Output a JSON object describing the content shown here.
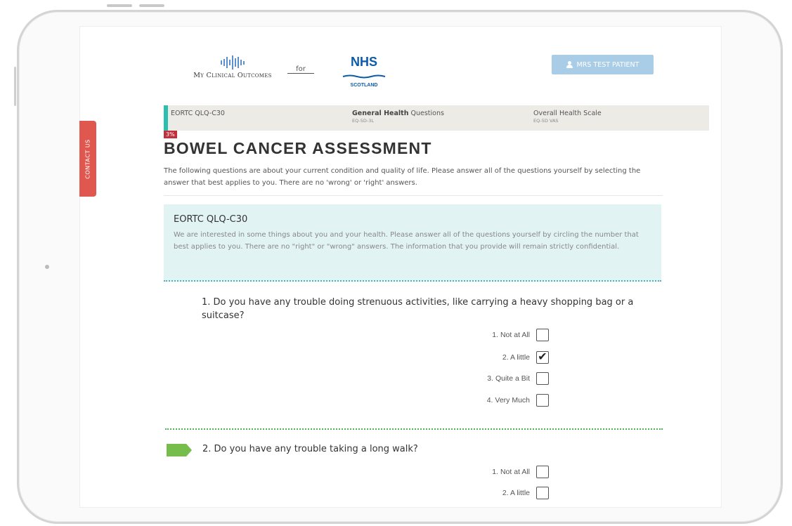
{
  "header": {
    "logo_text": "My Clinical Outcomes",
    "for_text": "for",
    "nhs_name": "NHS",
    "nhs_region": "SCOTLAND",
    "patient_button": "MRS TEST PATIENT"
  },
  "contact_tab": "CONTACT US",
  "steps": [
    {
      "title": "EORTC QLQ-C30",
      "sub": ""
    },
    {
      "title_bold": "General Health",
      "title_rest": " Questions",
      "sub": "EQ-5D-3L"
    },
    {
      "title": "Overall Health Scale",
      "sub": "EQ-5D VAS"
    }
  ],
  "progress_badge": "3%",
  "page": {
    "title": "BOWEL CANCER ASSESSMENT",
    "intro": "The following questions are about your current condition and quality of life. Please answer all of the questions yourself by selecting the answer that best applies to you. There are no 'wrong' or 'right' answers."
  },
  "section": {
    "title": "EORTC QLQ-C30",
    "text": "We are interested in some things about you and your health. Please answer all of the questions yourself by circling the number that best applies to you. There are no \"right\" or \"wrong\" answers. The information that you provide will remain strictly confidential."
  },
  "questions": [
    {
      "text": "1. Do you have any trouble doing strenuous activities, like carrying a heavy shopping bag or a suitcase?",
      "options": [
        {
          "label": "1. Not at All",
          "mark": ""
        },
        {
          "label": "2. A little",
          "mark": "✔"
        },
        {
          "label": "3. Quite a Bit",
          "mark": ""
        },
        {
          "label": "4. Very Much",
          "mark": ""
        }
      ]
    },
    {
      "text": "2. Do you have any trouble taking a long walk?",
      "options": [
        {
          "label": "1. Not at All",
          "mark": ""
        },
        {
          "label": "2. A little",
          "mark": ""
        }
      ]
    }
  ],
  "colors": {
    "accent_teal": "#2bbfb0",
    "badge_red": "#c0303b",
    "contact_red": "#e0574f",
    "nhs_blue": "#0a5ba8",
    "info_bg": "#e2f3f4",
    "current_question_arrow": "#76bd4c"
  }
}
